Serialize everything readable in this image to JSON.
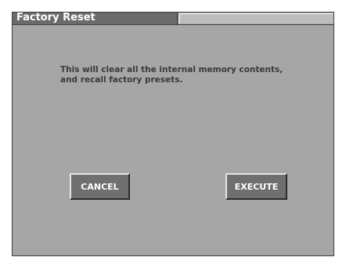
{
  "window": {
    "title": "Factory Reset"
  },
  "dialog": {
    "message_line1": "This will clear all the internal memory contents,",
    "message_line2": "and recall factory presets."
  },
  "buttons": {
    "cancel_label": "CANCEL",
    "execute_label": "EXECUTE"
  },
  "colors": {
    "screen_background": "#a6a6a6",
    "title_tab": "#6b6b6b",
    "button_face": "#6f6f6f",
    "text_dark": "#3a3a3a",
    "text_light": "#ffffff"
  }
}
